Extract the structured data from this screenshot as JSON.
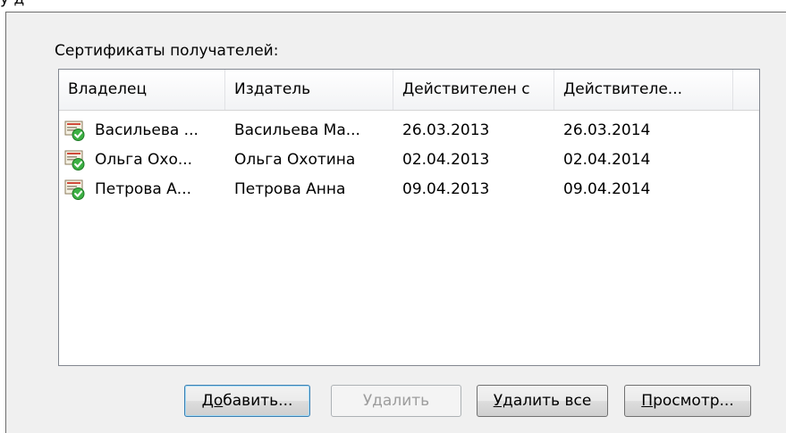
{
  "top_fragment": "у д",
  "section_label": "Сертификаты получателей:",
  "columns": [
    {
      "label": "Владелец"
    },
    {
      "label": "Издатель"
    },
    {
      "label": "Действителен с"
    },
    {
      "label": "Действителе..."
    }
  ],
  "rows": [
    {
      "owner": "Васильева ...",
      "issuer": "Васильева Ма...",
      "valid_from": "26.03.2013",
      "valid_to": "26.03.2014",
      "icon": "certificate-valid-icon"
    },
    {
      "owner": "Ольга Охо...",
      "issuer": "Ольга Охотина",
      "valid_from": "02.04.2013",
      "valid_to": "02.04.2014",
      "icon": "certificate-valid-icon"
    },
    {
      "owner": "Петрова А...",
      "issuer": "Петрова Анна",
      "valid_from": "09.04.2013",
      "valid_to": "09.04.2014",
      "icon": "certificate-valid-icon"
    }
  ],
  "buttons": {
    "add": {
      "underlined": "До",
      "rest": "бавить...",
      "enabled": true
    },
    "remove": {
      "label": "Удалить",
      "enabled": false
    },
    "remove_all": {
      "underlined": "Уд",
      "rest": "алить все",
      "enabled": true
    },
    "view": {
      "underlined": "П",
      "rest": "росмотр...",
      "enabled": true
    }
  },
  "colors": {
    "dialog_bg": "#f0f0f0",
    "list_bg": "#ffffff",
    "icon_green": "#3cb043"
  }
}
